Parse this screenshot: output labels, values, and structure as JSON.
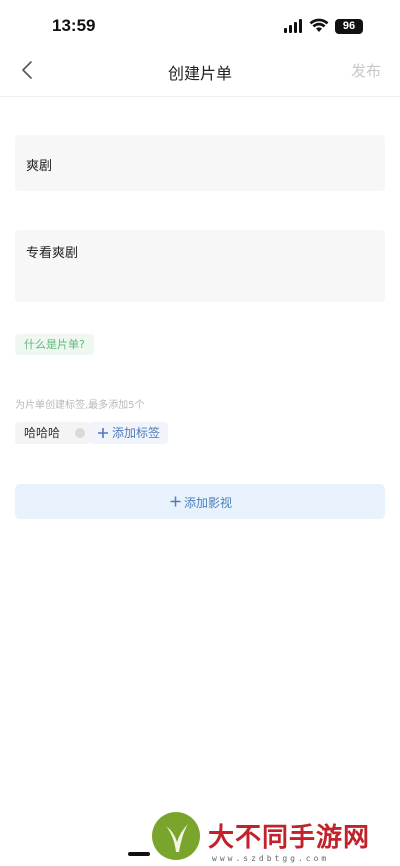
{
  "status_bar": {
    "time": "13:59",
    "battery": "96"
  },
  "nav": {
    "title": "创建片单",
    "publish_label": "发布"
  },
  "form": {
    "title_value": "爽剧",
    "description_value": "专看爽剧",
    "what_is_label": "什么是片单?",
    "tag_hint": "为片单创建标签,最多添加5个",
    "tags": [
      {
        "label": "哈哈哈"
      }
    ],
    "add_tag_label": "添加标签",
    "add_media_label": "添加影视"
  },
  "watermark": {
    "brand": "大不同手游网",
    "url": "www.szdbtgg.com"
  },
  "colors": {
    "accent_green": "#5fb87c",
    "accent_blue": "#4d7fbb",
    "add_media_bg": "#e7f2fd",
    "publish_disabled": "#c8c8c8"
  }
}
